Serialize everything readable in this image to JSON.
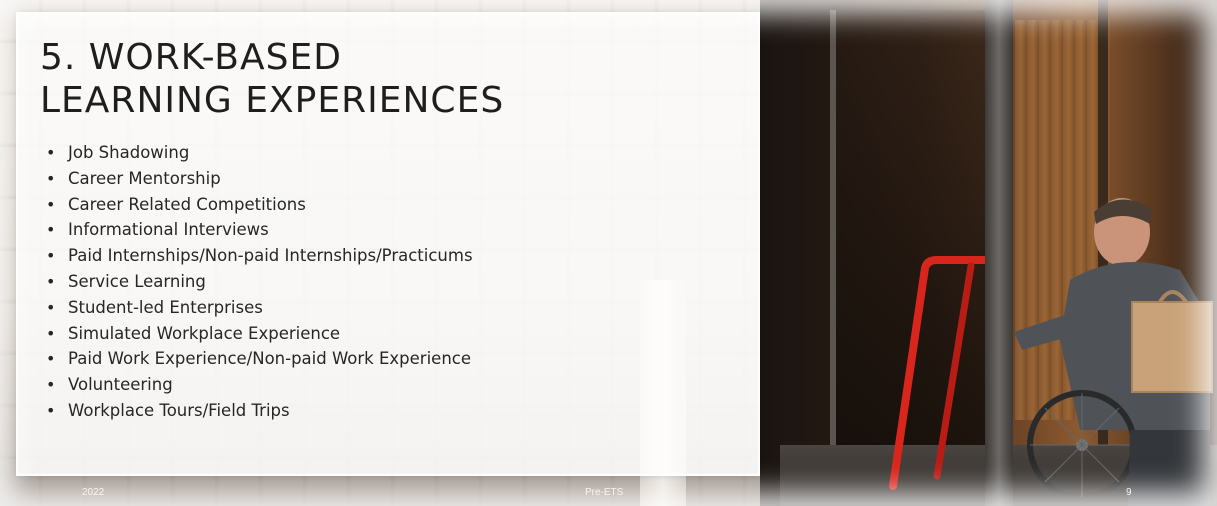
{
  "slide": {
    "title_lines": [
      "5. WORK-BASED",
      "LEARNING EXPERIENCES"
    ],
    "bullets": [
      "Job Shadowing",
      "Career Mentorship",
      "Career Related Competitions",
      "Informational Interviews",
      "Paid Internships/Non-paid Internships/Practicums",
      "Service Learning",
      "Student-led Enterprises",
      "Simulated Workplace Experience",
      "Paid Work Experience/Non-paid Work Experience",
      "Volunteering",
      "Workplace Tours/Field Trips"
    ],
    "bullet_glyph": "•",
    "footer": {
      "year": "2022",
      "center": "Pre-ETS",
      "page": "9"
    }
  },
  "colors": {
    "panel": "#ffffff",
    "text": "#1e1e1e",
    "handle": "#d9261c"
  }
}
